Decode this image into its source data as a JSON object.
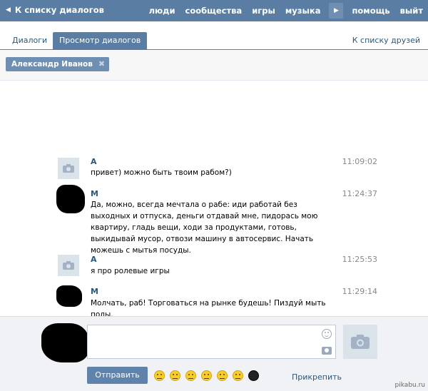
{
  "topbar": {
    "back_label": "К списку диалогов",
    "nav": [
      "люди",
      "сообщества",
      "игры",
      "музыка",
      "помощь",
      "выйт"
    ]
  },
  "tabs": {
    "dialogs": "Диалоги",
    "view": "Просмотр диалогов",
    "friends": "К списку друзей"
  },
  "recipient": {
    "name": "Александр Иванов"
  },
  "messages": [
    {
      "author": "А",
      "time": "11:09:02",
      "text": "привет) можно быть твоим рабом?)"
    },
    {
      "author": "М",
      "time": "11:24:37",
      "text": "Да, можно, всегда мечтала о рабе: иди работай без выходных и отпуска, деньги отдавай мне, пидорась мою квартиру, гладь вещи, ходи за продуктами, готовь, выкидывай мусор, отвози машину в автосервис. Начать можешь с мытья посуды."
    },
    {
      "author": "А",
      "time": "11:25:53",
      "text": "я про ролевые игры"
    },
    {
      "author": "М",
      "time": "11:29:14",
      "text": "Молчать, раб! Торговаться на рынке будешь! Пиздуй мыть полы."
    }
  ],
  "composer": {
    "send_label": "Отправить",
    "attach_label": "Прикрепить"
  },
  "watermark": "pikabu.ru",
  "colors": {
    "header": "#597da3",
    "link": "#2b587a"
  }
}
